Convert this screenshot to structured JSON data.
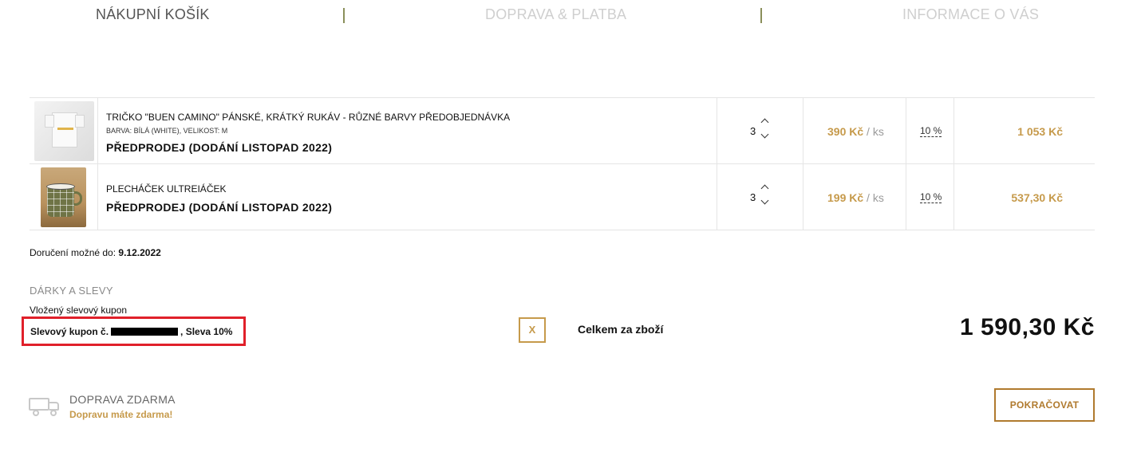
{
  "steps": [
    {
      "label": "NÁKUPNÍ KOŠÍK",
      "state": "active"
    },
    {
      "label": "DOPRAVA & PLATBA",
      "state": "inactive"
    },
    {
      "label": "INFORMACE O VÁS",
      "state": "inactive"
    }
  ],
  "cart": {
    "items": [
      {
        "image_icon": "tshirt-thumbnail",
        "name": "TRIČKO \"BUEN CAMINO\" PÁNSKÉ, KRÁTKÝ RUKÁV - RŮZNÉ BARVY PŘEDOBJEDNÁVKA",
        "variant": "BARVA: BÍLÁ (WHITE), VELIKOST: M",
        "presale": "PŘEDPRODEJ (DODÁNÍ LISTOPAD 2022)",
        "quantity": "3",
        "price": "390 Kč",
        "unit": "/ ks",
        "discount": "10 %",
        "total": "1 053 Kč"
      },
      {
        "image_icon": "mug-thumbnail",
        "name": "PLECHÁČEK ULTREIÁČEK",
        "variant": "",
        "presale": "PŘEDPRODEJ (DODÁNÍ LISTOPAD 2022)",
        "quantity": "3",
        "price": "199 Kč",
        "unit": "/ ks",
        "discount": "10 %",
        "total": "537,30 Kč"
      }
    ]
  },
  "delivery": {
    "label": "Doručení možné do:",
    "date": "9.12.2022"
  },
  "gifts": {
    "title": "DÁRKY A SLEVY",
    "coupon_label": "Vložený slevový kupon",
    "coupon_prefix": "Slevový kupon č.",
    "coupon_suffix": ", Sleva 10%",
    "remove_label": "X"
  },
  "summary": {
    "label": "Celkem za zboží",
    "total": "1 590,30 Kč"
  },
  "shipping": {
    "title": "DOPRAVA ZDARMA",
    "subtitle": "Dopravu máte zdarma!"
  },
  "actions": {
    "continue_label": "POKRAČOVAT"
  },
  "colors": {
    "accent": "#c69a4b",
    "button_border": "#b07a2e",
    "highlight_box": "#e0202a",
    "step_separator": "#8a8f5a"
  }
}
